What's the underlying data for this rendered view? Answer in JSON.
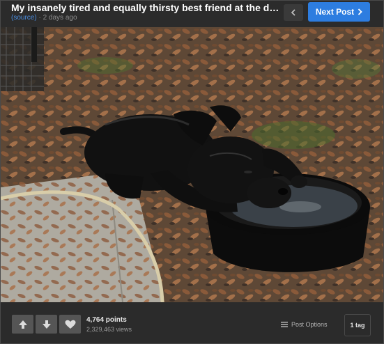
{
  "header": {
    "title": "My insanely tired and equally thirsty best friend at the do...",
    "source_label": "(source)",
    "separator": " · ",
    "time_ago": "2 days ago",
    "next_post_label": "Next Post"
  },
  "image": {
    "alt_semantic": "black dog resting head on edge of water bowl on leaf-covered ground"
  },
  "footer": {
    "points": "4,764 points",
    "views": "2,329,463 views",
    "post_options_label": "Post Options",
    "tag_label": "1 tag"
  },
  "icons": {
    "prev": "chevron-left-icon",
    "next": "chevron-right-icon",
    "upvote": "arrow-up-icon",
    "downvote": "arrow-down-icon",
    "favorite": "heart-icon",
    "menu": "menu-lines-icon"
  },
  "colors": {
    "background": "#2b2b2b",
    "accent": "#2d7de0",
    "link": "#4b8de0"
  }
}
